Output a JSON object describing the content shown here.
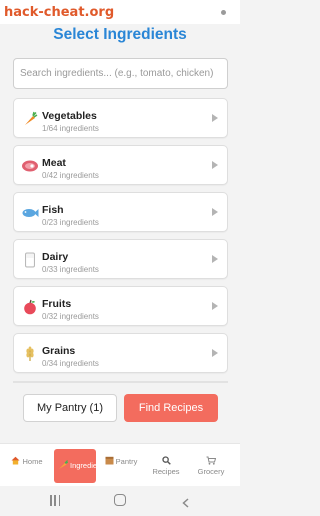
{
  "status_bar": {
    "site_text": "hack-cheat.org"
  },
  "header": {
    "title": "Select Ingredients"
  },
  "search": {
    "placeholder": "Search ingredients... (e.g., tomato, chicken)"
  },
  "categories": [
    {
      "name": "Vegetables",
      "count": "1/64 ingredients",
      "icon": "carrot-icon"
    },
    {
      "name": "Meat",
      "count": "0/42 ingredients",
      "icon": "steak-icon"
    },
    {
      "name": "Fish",
      "count": "0/23 ingredients",
      "icon": "fish-icon"
    },
    {
      "name": "Dairy",
      "count": "0/33 ingredients",
      "icon": "milk-icon"
    },
    {
      "name": "Fruits",
      "count": "0/32 ingredients",
      "icon": "apple-icon"
    },
    {
      "name": "Grains",
      "count": "0/34 ingredients",
      "icon": "wheat-icon"
    }
  ],
  "actions": {
    "pantry_label": "My Pantry (1)",
    "find_label": "Find Recipes"
  },
  "tabs": {
    "home": "Home",
    "ingredients": "Ingredients",
    "pantry": "Pantry",
    "recipes": "Recipes",
    "grocery": "Grocery"
  },
  "colors": {
    "accent": "#f36c5e",
    "title": "#2a86d6",
    "site": "#e05a2b"
  }
}
